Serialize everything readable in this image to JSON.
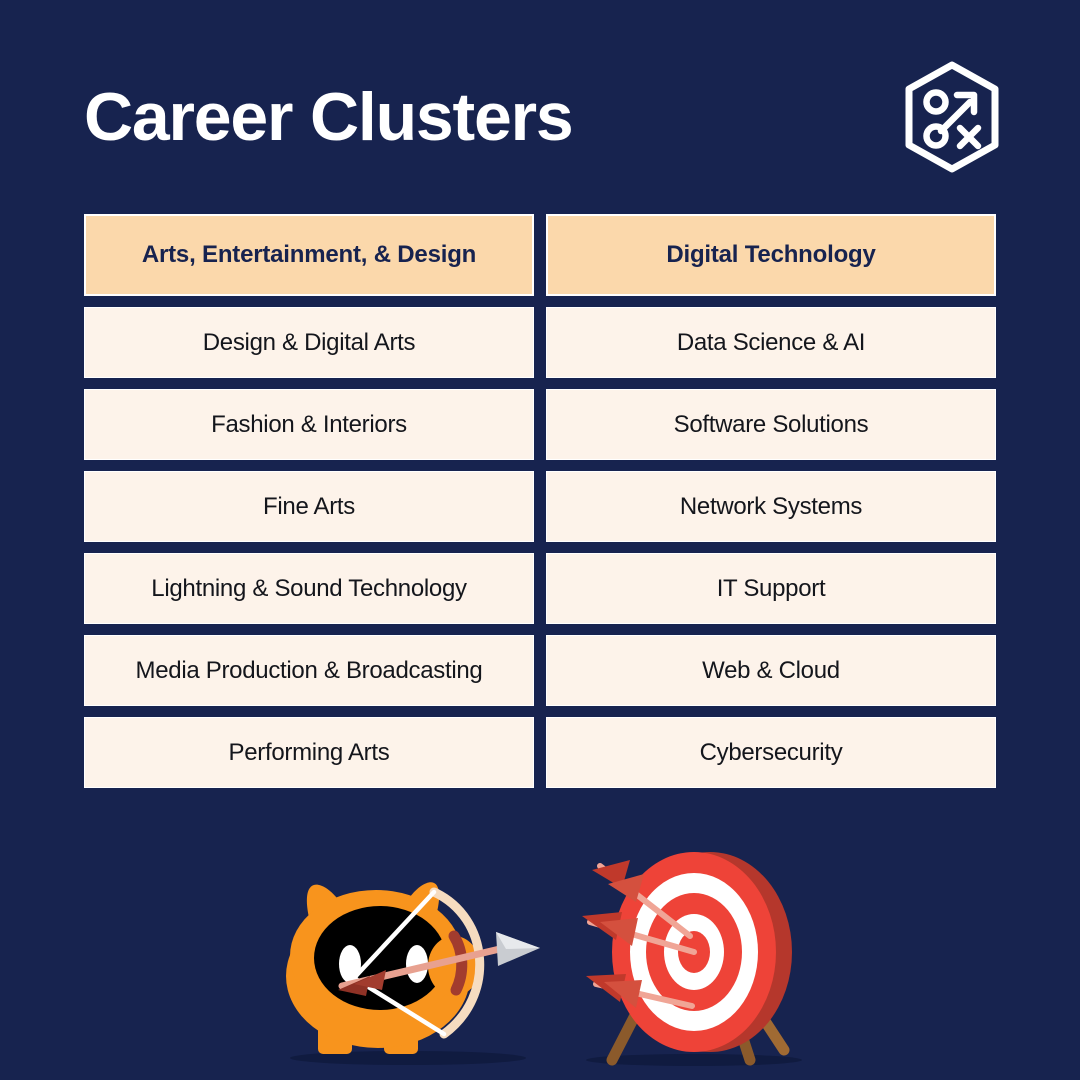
{
  "page": {
    "title": "Career Clusters",
    "background_color": "#17234f",
    "header_cell_color": "#fbd8ab",
    "cell_color": "#fdf3ea",
    "title_color": "#ffffff",
    "cell_text_color": "#14161c"
  },
  "logo": {
    "icon": "hexagon-strategy-icon",
    "color": "#ffffff"
  },
  "columns": [
    {
      "header": "Arts, Entertainment, & Design",
      "items": [
        "Design & Digital Arts",
        "Fashion & Interiors",
        "Fine Arts",
        "Lightning & Sound Technology",
        "Media Production & Broadcasting",
        "Performing Arts"
      ]
    },
    {
      "header": "Digital Technology",
      "items": [
        "Data Science & AI",
        "Software Solutions",
        "Network Systems",
        "IT Support",
        "Web & Cloud",
        "Cybersecurity"
      ]
    }
  ],
  "illustrations": {
    "mascot": {
      "name": "archer-cat-mascot",
      "body_color": "#f8941d",
      "face_color": "#000000",
      "eye_color": "#ffffff",
      "bow_color": "#f6dcc0",
      "arrow_color": "#e8a190"
    },
    "target": {
      "name": "archery-target",
      "ring_color": "#ee4338",
      "ring_alt_color": "#ffffff",
      "edge_color": "#b5372c",
      "leg_color": "#8b5a2b",
      "arrow_color": "#f0a596"
    }
  }
}
